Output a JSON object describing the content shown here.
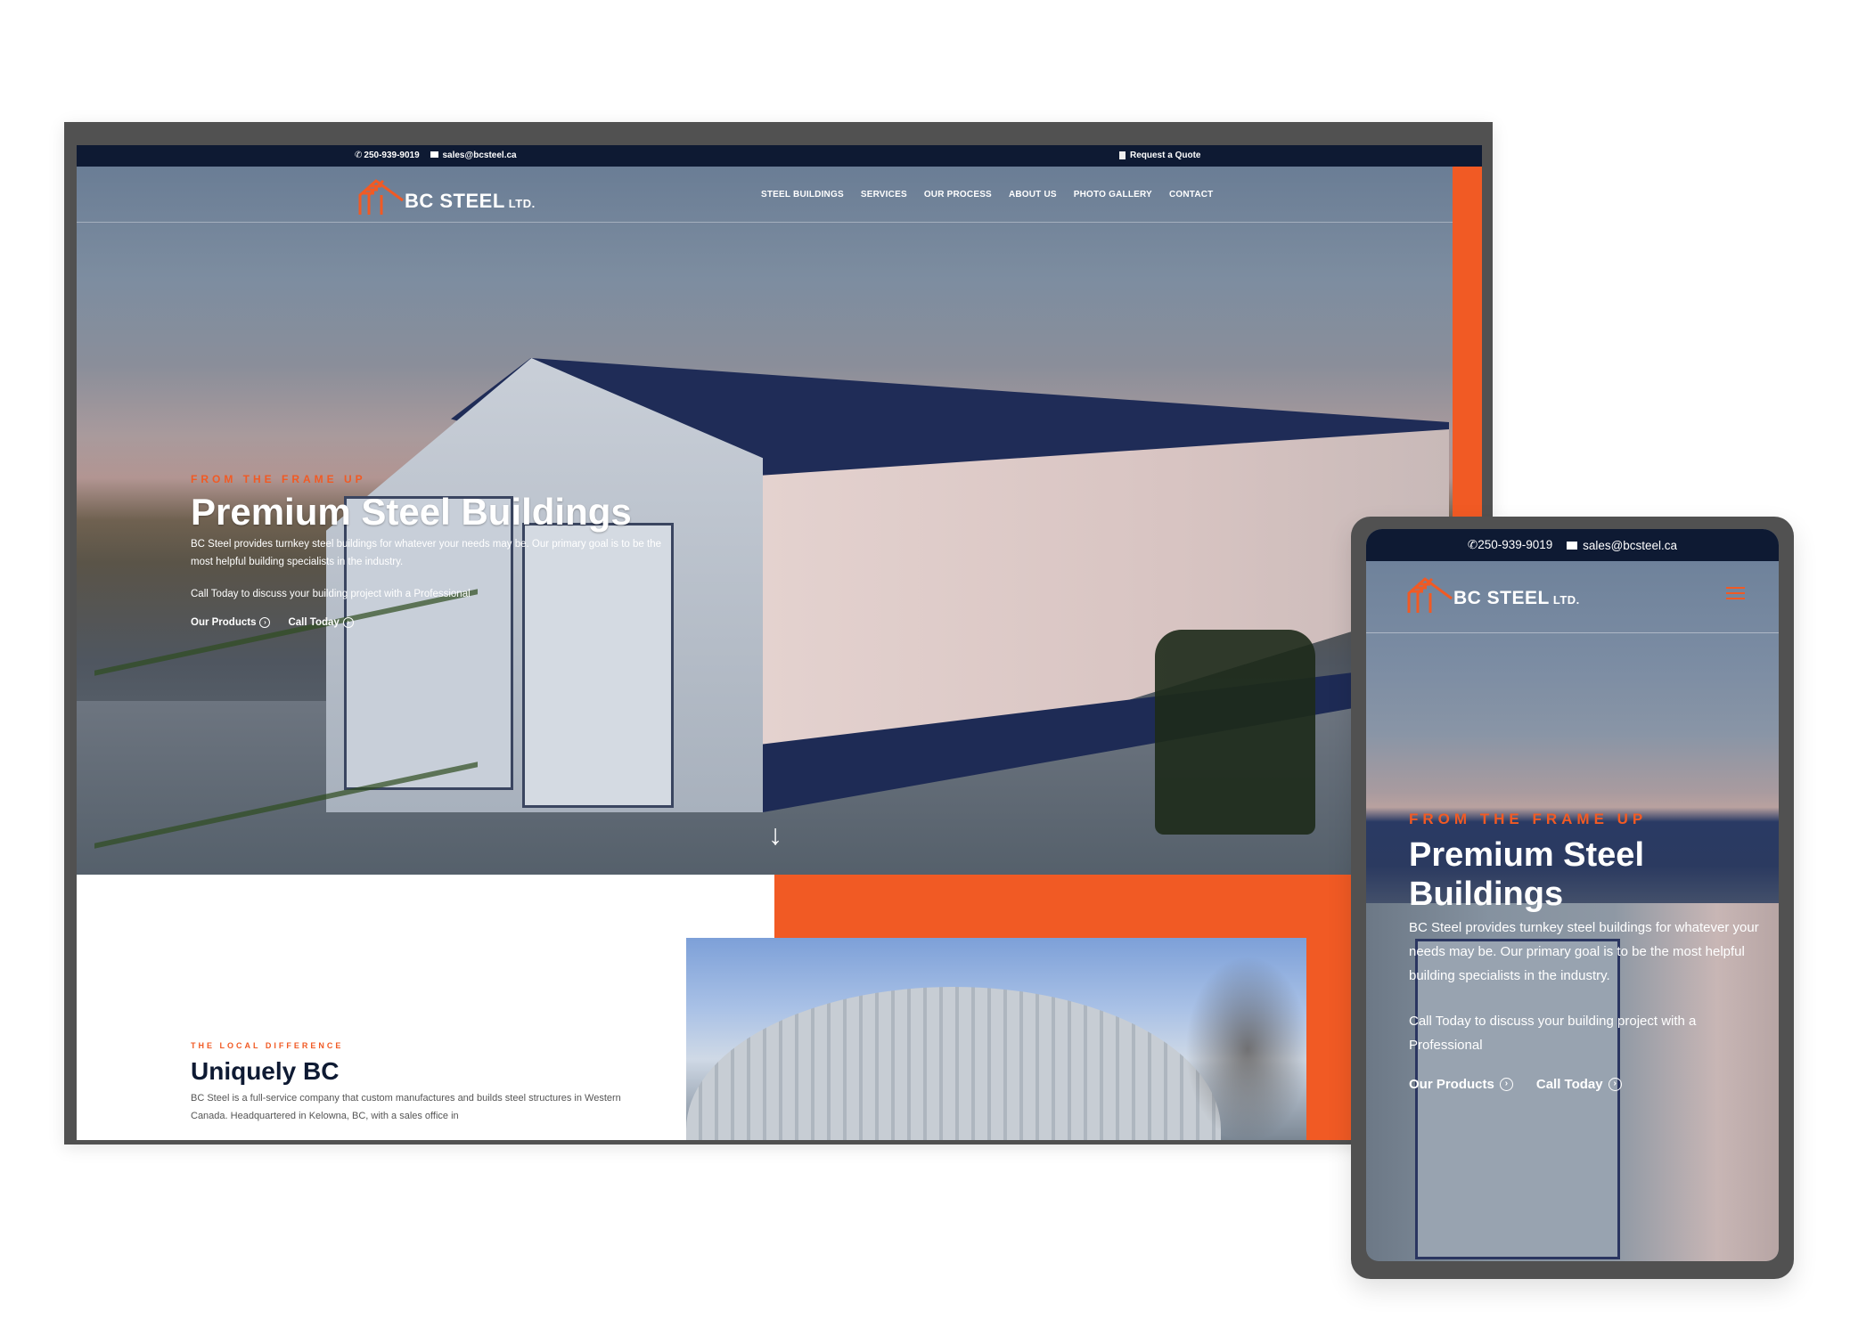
{
  "brand": {
    "name": "BC STEEL",
    "suffix": "LTD.",
    "accent_color": "#f15a24",
    "navy_color": "#0e1a33"
  },
  "topbar": {
    "phone_icon": "phone-icon",
    "phone": "250-939-9019",
    "email_icon": "envelope-icon",
    "email": "sales@bcsteel.ca",
    "quote_icon": "document-icon",
    "quote_label": "Request a Quote"
  },
  "nav": {
    "items": [
      {
        "label": "STEEL BUILDINGS"
      },
      {
        "label": "SERVICES"
      },
      {
        "label": "OUR PROCESS"
      },
      {
        "label": "ABOUT US"
      },
      {
        "label": "PHOTO GALLERY"
      },
      {
        "label": "CONTACT"
      }
    ],
    "menu_icon": "hamburger-icon"
  },
  "hero": {
    "eyebrow": "FROM THE FRAME UP",
    "title": "Premium Steel Buildings",
    "description": "BC Steel provides turnkey steel buildings for whatever your needs may be. Our primary goal is to be the most helpful building specialists in the industry.",
    "cta_text": "Call Today to discuss your building project with a Professional",
    "buttons": [
      {
        "label": "Our Products",
        "icon": "circle-chevron-right-icon"
      },
      {
        "label": "Call Today",
        "icon": "circle-chevron-right-icon"
      }
    ],
    "scroll_icon": "arrow-down-icon",
    "scroll_glyph": "↓",
    "chevron_glyph": "›"
  },
  "section2": {
    "eyebrow": "THE LOCAL DIFFERENCE",
    "title": "Uniquely BC",
    "body": "BC Steel is a full-service company that custom manufactures and builds steel structures in Western Canada. Headquartered in Kelowna, BC, with a sales office in"
  },
  "tablet": {
    "phone": "250-939-9019",
    "email": "sales@bcsteel.ca"
  },
  "icons": {
    "phone_glyph": "✆"
  }
}
